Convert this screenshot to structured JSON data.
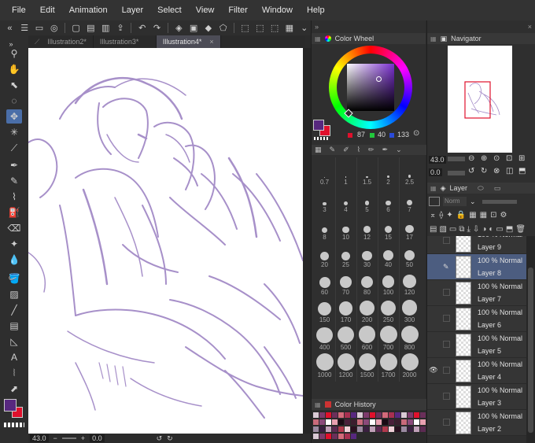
{
  "menu": [
    "File",
    "Edit",
    "Animation",
    "Layer",
    "Select",
    "View",
    "Filter",
    "Window",
    "Help"
  ],
  "tabs": [
    {
      "label": "Illustration2*",
      "active": false
    },
    {
      "label": "Illustration3*",
      "active": false
    },
    {
      "label": "Illustration4*",
      "active": true
    }
  ],
  "color_wheel": {
    "title": "Color Wheel",
    "r": "87",
    "g": "40",
    "b": "133",
    "current_color": "#57287f",
    "sub_color": "#e0102c"
  },
  "brush_size": {
    "sizes": [
      "0.7",
      "1",
      "1.5",
      "2",
      "2.5",
      "3",
      "4",
      "5",
      "6",
      "7",
      "8",
      "10",
      "12",
      "15",
      "17",
      "20",
      "25",
      "30",
      "40",
      "50",
      "60",
      "70",
      "80",
      "100",
      "120",
      "150",
      "170",
      "200",
      "250",
      "300",
      "400",
      "500",
      "600",
      "700",
      "800",
      "1000",
      "1200",
      "1500",
      "1700",
      "2000"
    ]
  },
  "color_history": {
    "title": "Color History"
  },
  "navigator": {
    "title": "Navigator",
    "zoom": "43.0",
    "rotation": "0.0"
  },
  "layer": {
    "title": "Layer",
    "blend_placeholder": "Norm",
    "rows": [
      {
        "mode": "100 % Normal",
        "name": "Layer 9",
        "selected": false,
        "visible": false
      },
      {
        "mode": "100 % Normal",
        "name": "Layer 8",
        "selected": true,
        "visible": false
      },
      {
        "mode": "100 % Normal",
        "name": "Layer 7",
        "selected": false,
        "visible": false
      },
      {
        "mode": "100 % Normal",
        "name": "Layer 6",
        "selected": false,
        "visible": false
      },
      {
        "mode": "100 % Normal",
        "name": "Layer 5",
        "selected": false,
        "visible": false
      },
      {
        "mode": "100 % Normal",
        "name": "Layer 4",
        "selected": false,
        "visible": true
      },
      {
        "mode": "100 % Normal",
        "name": "Layer 3",
        "selected": false,
        "visible": false
      },
      {
        "mode": "100 % Normal",
        "name": "Layer 2",
        "selected": false,
        "visible": false
      }
    ]
  },
  "status": {
    "zoom": "43.0",
    "rotation": "0.0"
  },
  "colors": {
    "accent": "#4a6ea8",
    "sketch": "#8a6bb8",
    "selected_layer": "#4c5d80"
  }
}
